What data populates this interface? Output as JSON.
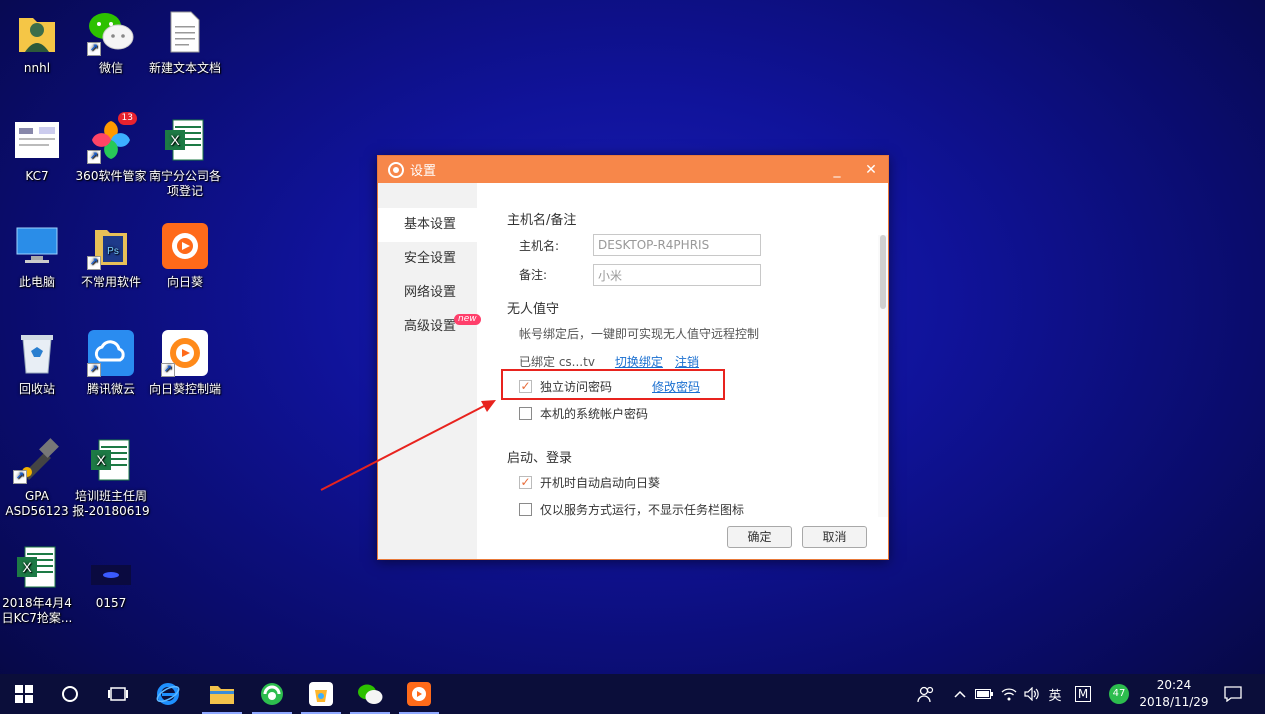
{
  "desktop": {
    "icons": [
      {
        "label": "nnhl"
      },
      {
        "label": "微信"
      },
      {
        "label": "新建文本文档"
      },
      {
        "label": "KC7"
      },
      {
        "label": "360软件管家",
        "badge": "13"
      },
      {
        "label": "南宁分公司各项登记"
      },
      {
        "label": "此电脑"
      },
      {
        "label": "不常用软件"
      },
      {
        "label": "向日葵"
      },
      {
        "label": "回收站"
      },
      {
        "label": "腾讯微云"
      },
      {
        "label": "向日葵控制端"
      },
      {
        "label": "GPA ASD56123"
      },
      {
        "label": "培训班主任周报-20180619"
      },
      {
        "label": "2018年4月4日KC7抢案..."
      },
      {
        "label": "0157"
      }
    ]
  },
  "dialog": {
    "title": "设置",
    "minimize": "_",
    "close": "✕",
    "nav": [
      {
        "label": "基本设置"
      },
      {
        "label": "安全设置"
      },
      {
        "label": "网络设置"
      },
      {
        "label": "高级设置",
        "badge": "new"
      }
    ],
    "hostname_section": "主机名/备注",
    "hostname_label": "主机名:",
    "hostname_value": "DESKTOP-R4PHRIS",
    "remark_label": "备注:",
    "remark_value": "小米",
    "unattended_section": "无人值守",
    "unattended_desc": "帐号绑定后，一键即可实现无人值守远程控制",
    "bound_label": "已绑定 cs...tv",
    "switch_bind": "切换绑定",
    "logout": "注销",
    "independent_password": "独立访问密码",
    "change_password": "修改密码",
    "system_password": "本机的系统帐户密码",
    "startup_section": "启动、登录",
    "autostart": "开机时自动启动向日葵",
    "service_mode": "仅以服务方式运行，不显示任务栏图标",
    "ok": "确定",
    "cancel": "取消",
    "checkmark": "✓"
  },
  "taskbar": {
    "ime_lang": "英",
    "ime_mode": "M",
    "notification_count": "47",
    "time": "20:24",
    "date": "2018/11/29"
  },
  "colors": {
    "accent": "#f7874a",
    "highlight_red": "#e8231e",
    "link": "#1a6fd0"
  }
}
